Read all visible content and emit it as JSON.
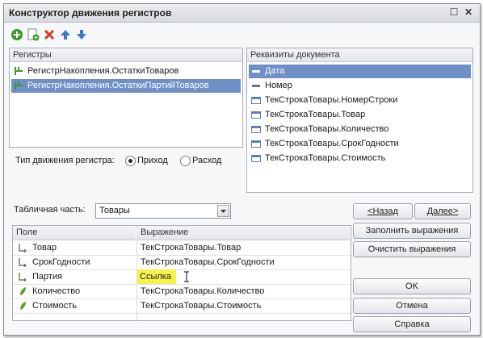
{
  "window": {
    "title": "Конструктор движения регистров"
  },
  "registers": {
    "header": "Регистры",
    "items": [
      {
        "label": "РегистрНакопления.ОстаткиТоваров",
        "selected": false
      },
      {
        "label": "РегистрНакопления.ОстаткиПартийТоваров",
        "selected": true
      }
    ]
  },
  "details": {
    "header": "Реквизиты документа",
    "items": [
      {
        "label": "Дата",
        "selected": true,
        "icon": "attribute-icon"
      },
      {
        "label": "Номер",
        "selected": false,
        "icon": "attribute-icon"
      },
      {
        "label": "ТекСтрокаТовары.НомерСтроки",
        "selected": false,
        "icon": "table-field-icon"
      },
      {
        "label": "ТекСтрокаТовары.Товар",
        "selected": false,
        "icon": "table-field-icon"
      },
      {
        "label": "ТекСтрокаТовары.Количество",
        "selected": false,
        "icon": "table-field-icon"
      },
      {
        "label": "ТекСтрокаТовары.СрокГодности",
        "selected": false,
        "icon": "table-field-icon"
      },
      {
        "label": "ТекСтрокаТовары.Стоимость",
        "selected": false,
        "icon": "table-field-icon"
      }
    ]
  },
  "movement": {
    "label": "Тип движения регистра:",
    "option_income": "Приход",
    "option_expense": "Расход",
    "selected": "Приход"
  },
  "tabular": {
    "label": "Табличная часть:",
    "value": "Товары"
  },
  "grid": {
    "col_field": "Поле",
    "col_expr": "Выражение",
    "rows": [
      {
        "field": "Товар",
        "expr": "ТекСтрокаТовары.Товар",
        "icon": "dimension-icon"
      },
      {
        "field": "СрокГодности",
        "expr": "ТекСтрокаТовары.СрокГодности",
        "icon": "dimension-icon"
      },
      {
        "field": "Партия",
        "expr": "Ссылка",
        "icon": "dimension-icon",
        "editing": true
      },
      {
        "field": "Количество",
        "expr": "ТекСтрокаТовары.Количество",
        "icon": "resource-icon"
      },
      {
        "field": "Стоимость",
        "expr": "ТекСтрокаТовары.Стоимость",
        "icon": "resource-icon"
      }
    ]
  },
  "buttons": {
    "back": "<Назад",
    "next": "Далее>",
    "fill": "Заполнить выражения",
    "clear": "Очистить выражения",
    "ok": "OK",
    "cancel": "Отмена",
    "help": "Справка"
  },
  "colors": {
    "selection": "#6f8fc7",
    "highlight": "#f4f34a",
    "add_green": "#3a9a2c",
    "delete_red": "#d23a2a",
    "arrow_blue": "#3d78c9"
  }
}
